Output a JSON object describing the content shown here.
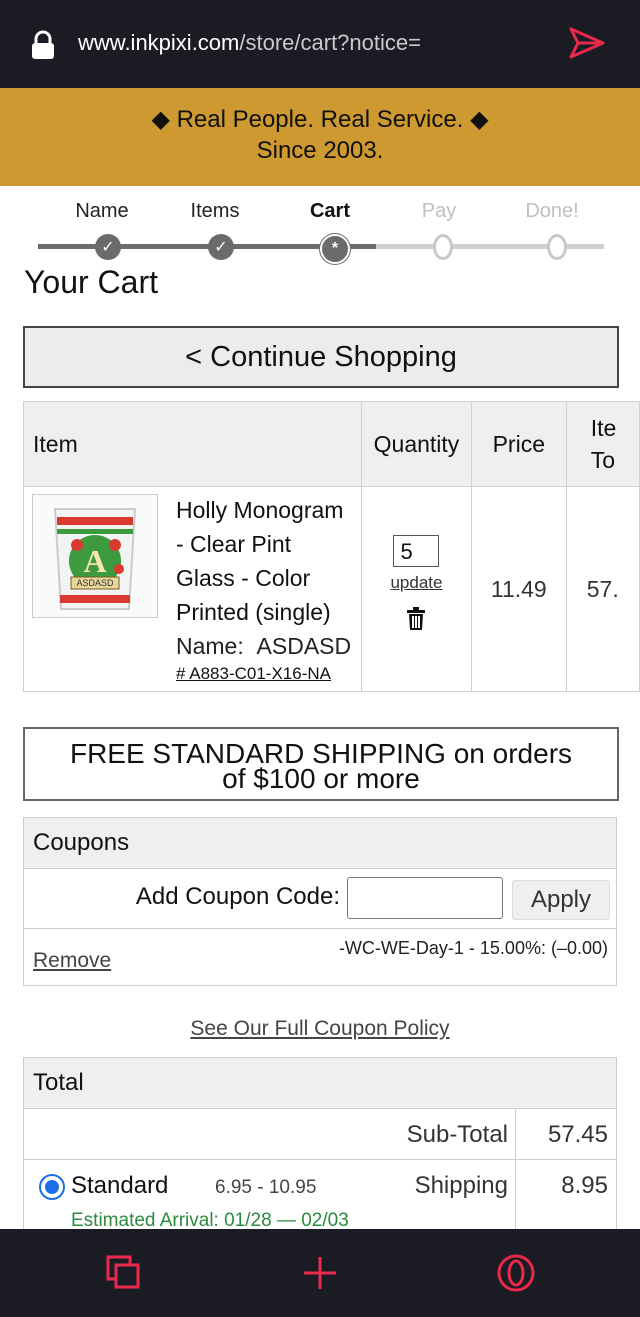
{
  "browser": {
    "url_domain": "www.inkpixi.com",
    "url_path": "/store/cart?notice="
  },
  "banner": {
    "line1": "◆ Real People.  Real Service. ◆",
    "line2": "Since 2003."
  },
  "steps": [
    {
      "label": "Name",
      "state": "done",
      "mark": "✓"
    },
    {
      "label": "Items",
      "state": "done",
      "mark": "✓"
    },
    {
      "label": "Cart",
      "state": "current",
      "mark": "*"
    },
    {
      "label": "Pay",
      "state": "todo",
      "mark": ""
    },
    {
      "label": "Done!",
      "state": "todo",
      "mark": ""
    }
  ],
  "page_title": "Your Cart",
  "continue_label": "< Continue Shopping",
  "cart_table": {
    "headers": {
      "item": "Item",
      "quantity": "Quantity",
      "price": "Price",
      "total_line1": "Ite",
      "total_line2": "To"
    },
    "row": {
      "desc_line1": "Holly Monogram",
      "desc_line2": "- Clear Pint",
      "desc_line3": "Glass - Color",
      "desc_line4": "Printed (single)",
      "name_label": "Name:",
      "name_value": "ASDASD",
      "sku": "# A883-C01-X16-NA",
      "thumb_letter": "A",
      "thumb_text": "ASDASD",
      "quantity": "5",
      "update_label": "update",
      "price": "11.49",
      "item_total": "57."
    }
  },
  "shipping_notice": {
    "line1": "FREE STANDARD SHIPPING on orders",
    "line2": "of $100 or more"
  },
  "coupons": {
    "header": "Coupons",
    "add_label": "Add Coupon Code:",
    "input_value": "",
    "apply_label": "Apply",
    "remove_label": "Remove",
    "applied": "-WC-WE-Day-1 - 15.00%: (–0.00)"
  },
  "coupon_policy_link": "See Our Full Coupon Policy",
  "totals": {
    "header": "Total",
    "subtotal_label": "Sub-Total",
    "subtotal_value": "57.45",
    "shipping_option": "Standard",
    "shipping_range": "6.95 - 10.95",
    "shipping_label": "Shipping",
    "shipping_value": "8.95",
    "estimated_arrival": "Estimated Arrival: 01/28 — 02/03"
  },
  "colors": {
    "banner": "#cd9930",
    "bars": "#1b1b23",
    "accent_red": "#e8294b",
    "radio_blue": "#1a6fe8",
    "arrival_green": "#2b8a3e"
  }
}
